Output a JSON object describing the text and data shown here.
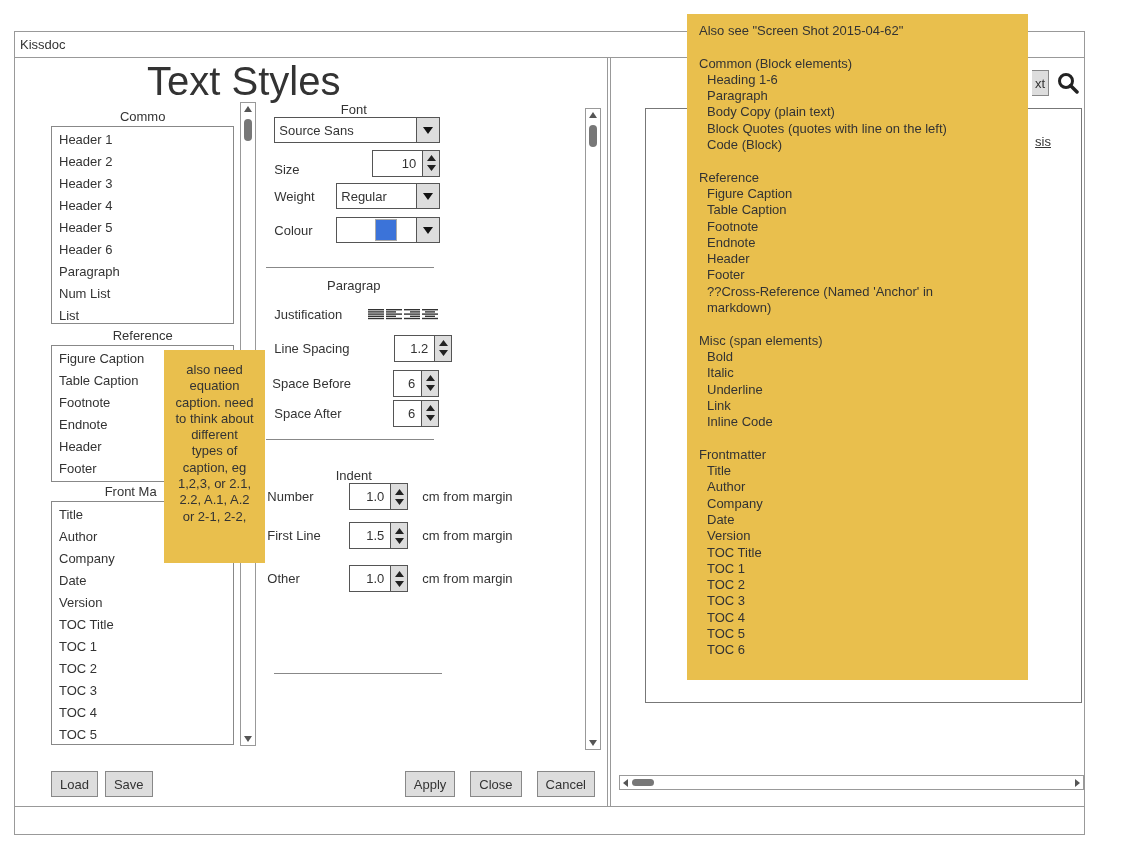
{
  "window": {
    "title": "Kissdoc"
  },
  "styles_panel": {
    "title": "Text Styles",
    "groups": [
      {
        "label": "Commo",
        "items": [
          "Header 1",
          "Header 2",
          "Header 3",
          "Header 4",
          "Header 5",
          "Header 6",
          "Paragraph",
          "Num List",
          "List"
        ]
      },
      {
        "label": "Reference",
        "items": [
          "Figure Caption",
          "Table Caption",
          "Footnote",
          "Endnote",
          "Header",
          "Footer"
        ]
      },
      {
        "label": "Front Ma",
        "items": [
          "Title",
          "Author",
          "Company",
          "Date",
          "Version",
          "TOC Title",
          "TOC 1",
          "TOC 2",
          "TOC 3",
          "TOC 4",
          "TOC 5"
        ]
      }
    ]
  },
  "font": {
    "label": "Font",
    "family": "Source Sans",
    "size_label": "Size",
    "size": "10",
    "weight_label": "Weight",
    "weight": "Regular",
    "colour_label": "Colour"
  },
  "paragraph": {
    "label": "Paragrap",
    "justification_label": "Justification",
    "line_spacing_label": "Line Spacing",
    "line_spacing": "1.2",
    "space_before_label": "Space Before",
    "space_before": "6",
    "space_after_label": "Space After",
    "space_after": "6"
  },
  "indent": {
    "label": "Indent",
    "rows": [
      {
        "label": "Number",
        "value": "1.0",
        "unit": "cm from margin"
      },
      {
        "label": "First Line",
        "value": "1.5",
        "unit": "cm from margin"
      },
      {
        "label": "Other",
        "value": "1.0",
        "unit": "cm from margin"
      }
    ]
  },
  "left_buttons": [
    "Load",
    "Save"
  ],
  "right_buttons": [
    "Apply",
    "Close",
    "Cancel"
  ],
  "preview": {
    "button": "xt",
    "link": "sis"
  },
  "caption_note": {
    "text": "also need equation caption. need to think about different types of caption, eg 1,2,3, or 2.1, 2.2, A.1, A.2  or 2-1, 2-2,"
  },
  "elements_note": {
    "intro": "Also see \"Screen Shot 2015-04-62\"",
    "sections": [
      {
        "heading": "Common (Block elements)",
        "items": [
          "Heading 1-6",
          "Paragraph",
          "Body Copy (plain text)",
          "Block Quotes (quotes with line on the left)",
          "Code (Block)"
        ]
      },
      {
        "heading": "Reference",
        "items": [
          "Figure Caption",
          "Table Caption",
          "Footnote",
          "Endnote",
          "Header",
          "Footer",
          "??Cross-Reference (Named 'Anchor' in markdown)"
        ]
      },
      {
        "heading": "Misc (span elements)",
        "items": [
          "Bold",
          "Italic",
          "Underline",
          "Link",
          "Inline Code"
        ]
      },
      {
        "heading": "Frontmatter",
        "items": [
          "Title",
          "Author",
          "Company",
          "Date",
          "Version",
          "TOC Title",
          "TOC 1",
          "TOC 2",
          "TOC 3",
          "TOC 4",
          "TOC 5",
          "TOC 6"
        ]
      }
    ]
  }
}
